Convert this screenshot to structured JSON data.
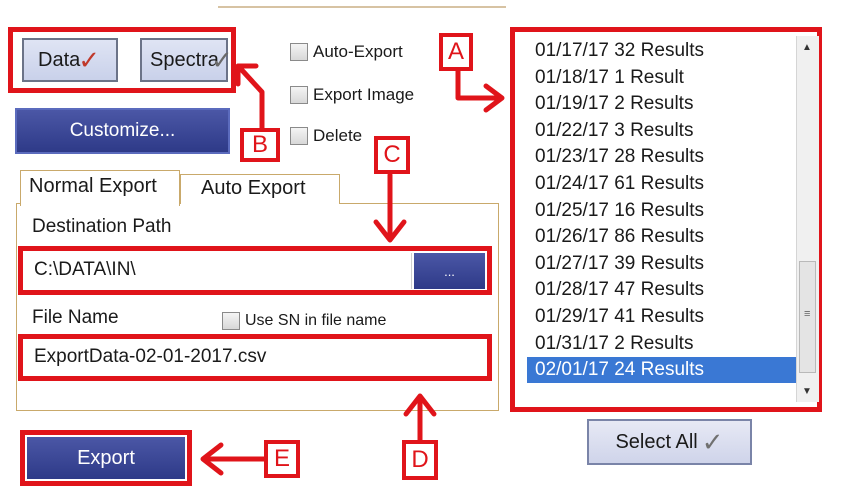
{
  "buttons": {
    "data_label": "Data",
    "spectra_label": "Spectra",
    "customize_label": "Customize...",
    "browse_label": "...",
    "export_label": "Export",
    "select_all_label": "Select All"
  },
  "options": {
    "auto_export": "Auto-Export",
    "export_image": "Export Image",
    "delete": "Delete"
  },
  "tabs": [
    {
      "label": "Normal Export",
      "active": true
    },
    {
      "label": "Auto Export",
      "active": false
    }
  ],
  "form": {
    "destination_label": "Destination Path",
    "destination_value": "C:\\DATA\\IN\\",
    "filename_label": "File Name",
    "use_sn_label": "Use SN in file name",
    "filename_value": "ExportData-02-01-2017.csv"
  },
  "results_list": [
    "01/17/17 32 Results",
    "01/18/17 1 Result",
    "01/19/17 2 Results",
    "01/22/17 3 Results",
    "01/23/17 28 Results",
    "01/24/17 61 Results",
    "01/25/17 16 Results",
    "01/26/17 86 Results",
    "01/27/17 39 Results",
    "01/28/17 47 Results",
    "01/29/17 41 Results",
    "01/31/17 2 Results",
    "02/01/17 24 Results"
  ],
  "selected_result": "02/01/17 24 Results",
  "callouts": {
    "a": "A",
    "b": "B",
    "c": "C",
    "d": "D",
    "e": "E"
  },
  "colors": {
    "annotation_red": "#e0141a",
    "selection_blue": "#3a78d4",
    "button_navy": "#2e3a88"
  }
}
